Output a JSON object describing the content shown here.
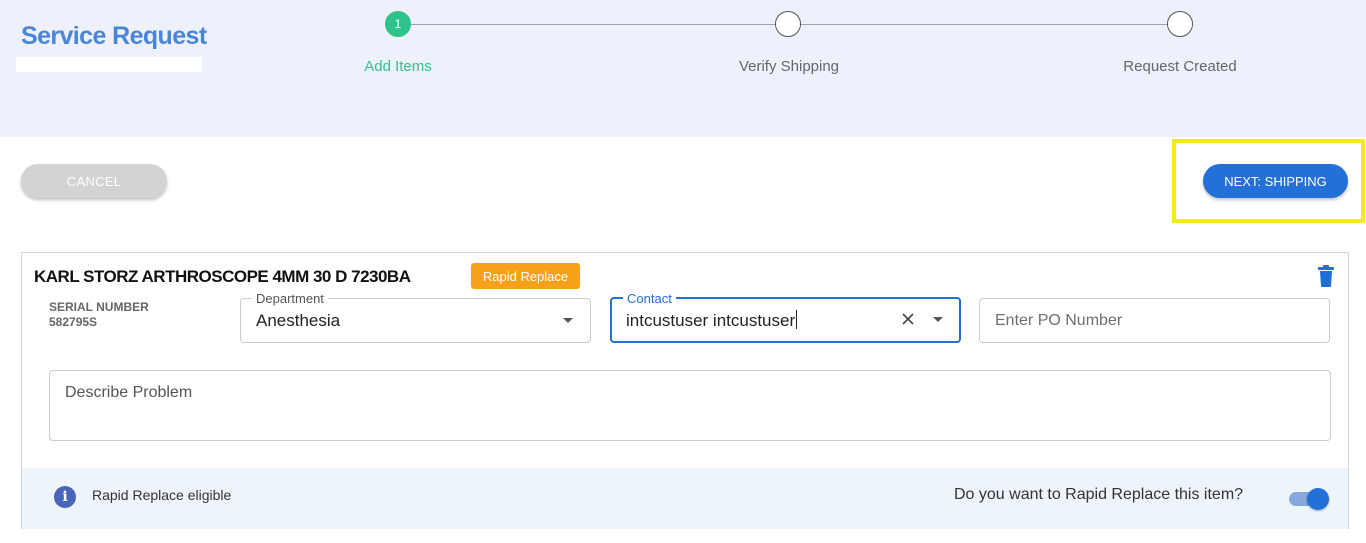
{
  "header": {
    "title": "Service Request"
  },
  "stepper": {
    "steps": [
      {
        "number": "1",
        "label": "Add Items",
        "state": "active"
      },
      {
        "number": "",
        "label": "Verify Shipping",
        "state": "pending"
      },
      {
        "number": "",
        "label": "Request Created",
        "state": "pending"
      }
    ]
  },
  "actions": {
    "cancel_label": "CANCEL",
    "next_label": "NEXT: SHIPPING"
  },
  "item": {
    "title": "KARL STORZ ARTHROSCOPE 4MM 30 D 7230BA",
    "badge": "Rapid Replace",
    "serial_label": "SERIAL NUMBER",
    "serial_value": "582795S",
    "department": {
      "label": "Department",
      "value": "Anesthesia"
    },
    "contact": {
      "label": "Contact",
      "value": "intcustuser intcustuser"
    },
    "po_number": {
      "placeholder": "Enter PO Number"
    },
    "description": {
      "placeholder": "Describe Problem"
    },
    "eligibility_text": "Rapid Replace eligible",
    "rapid_replace_question": "Do you want to Rapid Replace this item?",
    "rapid_replace_enabled": true
  },
  "colors": {
    "brand": "#4a86d8",
    "step_active": "#2ec38a",
    "primary_button": "#2270d8",
    "badge": "#f7a11a",
    "highlight_outline": "#f4ea1c"
  },
  "icons": [
    "trash-icon",
    "clear-icon",
    "chevron-down-icon",
    "info-icon",
    "toggle-switch"
  ]
}
